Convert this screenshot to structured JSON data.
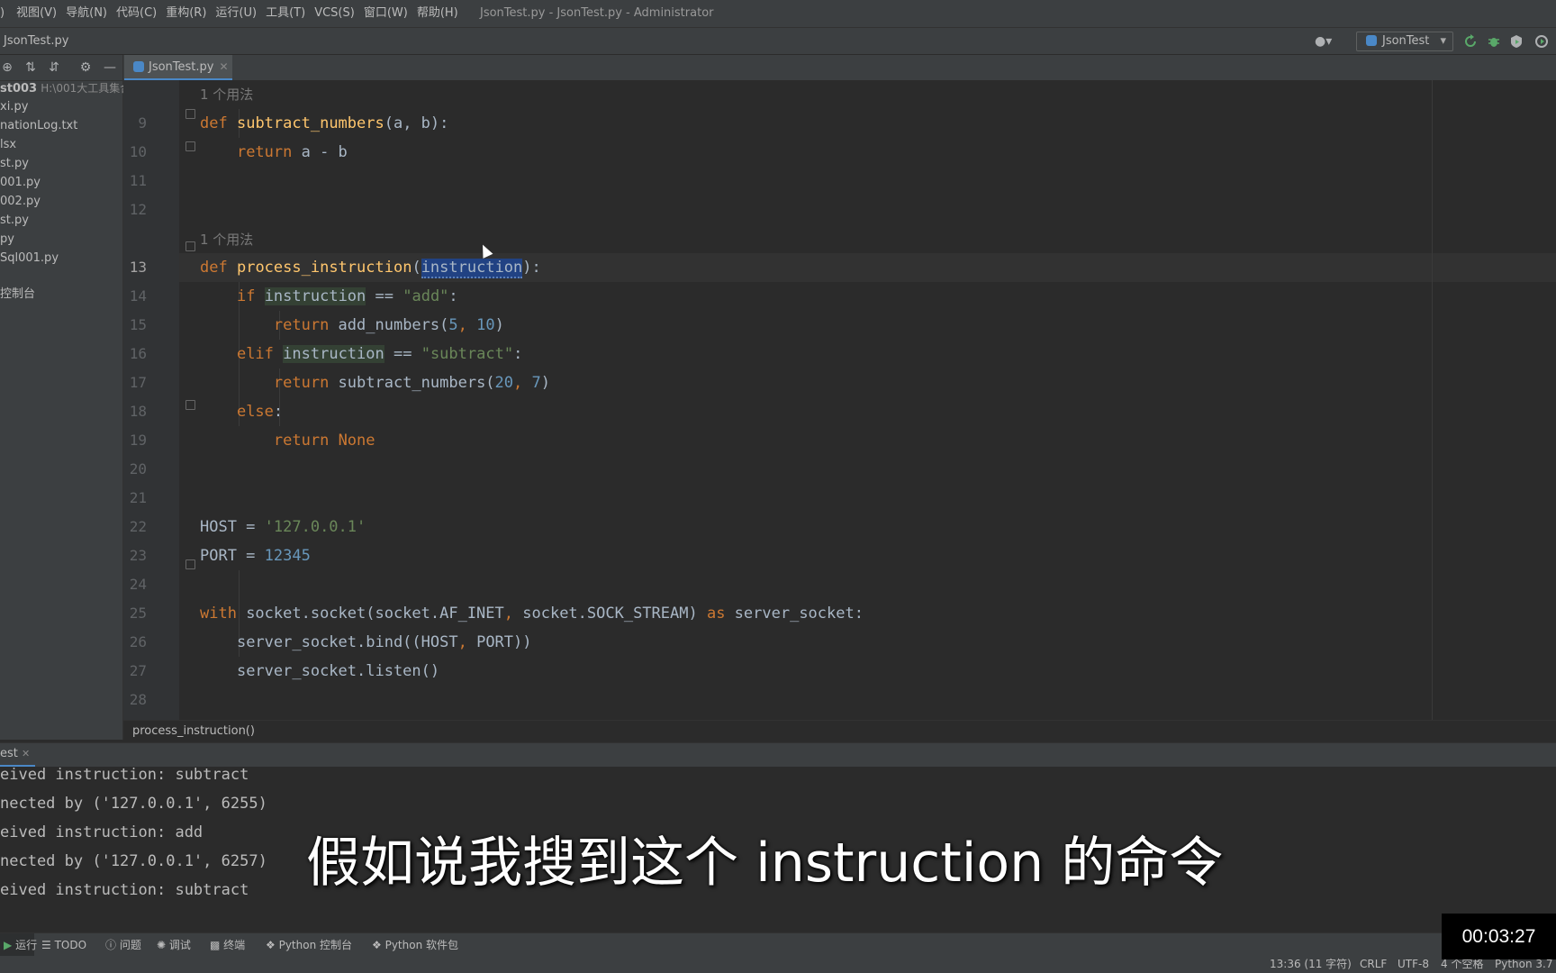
{
  "menu": {
    "items": [
      "视图(V)",
      "导航(N)",
      "代码(C)",
      "重构(R)",
      "运行(U)",
      "工具(T)",
      "VCS(S)",
      "窗口(W)",
      "帮助(H)"
    ],
    "window_title": "JsonTest.py - JsonTest.py - Administrator"
  },
  "navbar": {
    "file": "JsonTest.py",
    "run_config": "JsonTest"
  },
  "sidebar": {
    "project": "st003",
    "project_path": "H:\\001大工具集合",
    "files": [
      "xi.py",
      "nationLog.txt",
      "lsx",
      "st.py",
      "001.py",
      "002.py",
      "st.py",
      "py",
      "Sql001.py"
    ],
    "console_item": "控制台"
  },
  "editor": {
    "tab": "JsonTest.py",
    "usage_hint": "1 个用法",
    "line_numbers": [
      "9",
      "10",
      "11",
      "12",
      "13",
      "14",
      "15",
      "16",
      "17",
      "18",
      "19",
      "20",
      "21",
      "22",
      "23",
      "24",
      "25",
      "26",
      "27",
      "28"
    ],
    "code": {
      "l9": {
        "kw": "def",
        "fn": "subtract_numbers",
        "rest": "(a, b):"
      },
      "l10": {
        "kw": "return",
        "rest": " a - b"
      },
      "l13": {
        "kw": "def",
        "fn": "process_instruction",
        "open": "(",
        "param": "instruction",
        "close": "):"
      },
      "l14": {
        "kw": "if",
        "var": "instruction",
        "op": " == ",
        "str": "\"add\"",
        "end": ":"
      },
      "l15": {
        "kw": "return",
        "call": " add_numbers(",
        "n1": "5",
        "sep": ", ",
        "n2": "10",
        "end": ")"
      },
      "l16": {
        "kw": "elif",
        "var": "instruction",
        "op": " == ",
        "str": "\"subtract\"",
        "end": ":"
      },
      "l17": {
        "kw": "return",
        "call": " subtract_numbers(",
        "n1": "20",
        "sep": ", ",
        "n2": "7",
        "end": ")"
      },
      "l18": {
        "kw": "else",
        "end": ":"
      },
      "l19": {
        "kw": "return",
        "kw2": "None"
      },
      "l22": {
        "name": "HOST = ",
        "str": "'127.0.0.1'"
      },
      "l23": {
        "name": "PORT = ",
        "num": "12345"
      },
      "l25": {
        "kw": "with",
        "mid": " socket.socket(socket.AF_INET",
        "sep": ",",
        "mid2": " socket.SOCK_STREAM) ",
        "kw2": "as",
        "end": " server_socket:"
      },
      "l26": {
        "text": "server_socket.bind((HOST",
        "sep": ",",
        "end": " PORT))"
      },
      "l27": {
        "text": "server_socket.listen()"
      }
    },
    "breadcrumb": "process_instruction()"
  },
  "run_panel": {
    "tab": "est",
    "lines": [
      "eived instruction: subtract",
      "nected by ('127.0.0.1', 6255)",
      "eived instruction: add",
      "nected by ('127.0.0.1', 6257)",
      "eived instruction: subtract"
    ]
  },
  "subtitle": "假如说我搜到这个 instruction 的命令",
  "toolwindows": {
    "run": "运行",
    "todo": "TODO",
    "problems": "问题",
    "debug": "调试",
    "terminal": "终端",
    "python_console": "Python 控制台",
    "python_packages": "Python 软件包"
  },
  "status": {
    "position": "13:36 (11 字符)",
    "line_sep": "CRLF",
    "encoding": "UTF-8",
    "indent": "4 个空格",
    "interpreter": "Python 3.7"
  },
  "timer": "00:03:27"
}
